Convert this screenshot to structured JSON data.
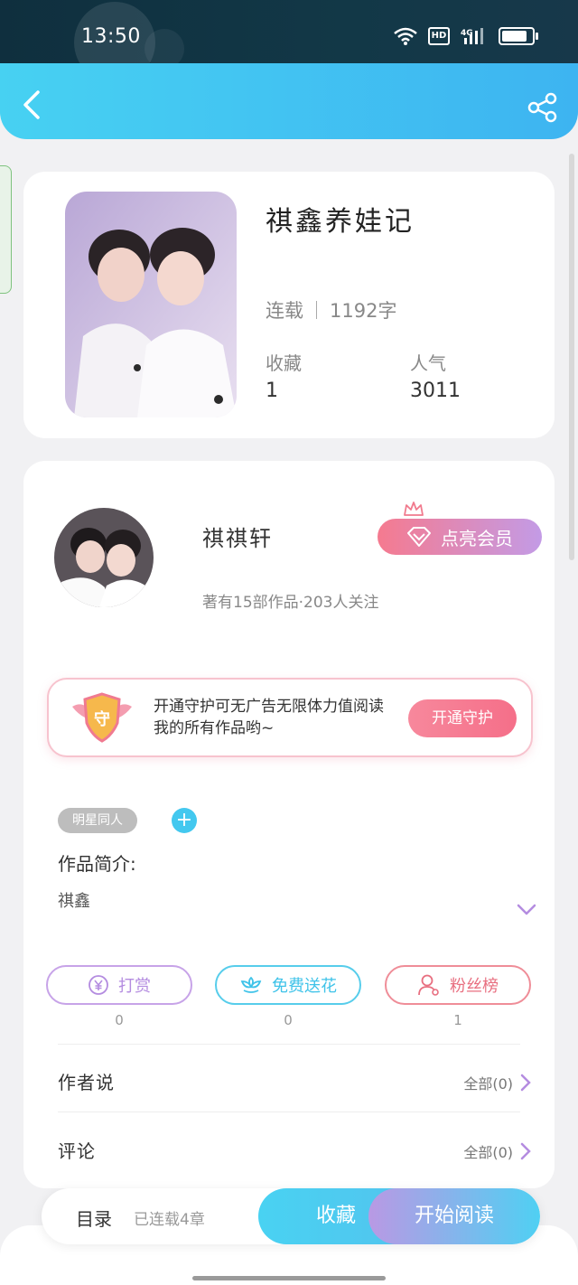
{
  "status": {
    "time": "13:50",
    "hd": "HD",
    "network": "4G",
    "battery_level": 0.85
  },
  "book": {
    "title": "祺鑫养娃记",
    "status": "连载",
    "word_count": "1192字",
    "favorites_label": "收藏",
    "favorites_value": "1",
    "popularity_label": "人气",
    "popularity_value": "3011"
  },
  "author": {
    "name": "祺祺轩",
    "stats": "著有15部作品·203人关注",
    "vip_button": "点亮会员"
  },
  "guard": {
    "badge_char": "守",
    "text": "开通守护可无广告无限体力值阅读我的所有作品哟~",
    "button": "开通守护"
  },
  "tags": [
    "明星同人"
  ],
  "intro": {
    "label": "作品简介:",
    "text": "祺鑫"
  },
  "actions": [
    {
      "label": "打赏",
      "count": "0",
      "icon": "yen-icon"
    },
    {
      "label": "免费送花",
      "count": "0",
      "icon": "flower-icon"
    },
    {
      "label": "粉丝榜",
      "count": "1",
      "icon": "user-icon"
    }
  ],
  "sections": {
    "author_says": {
      "title": "作者说",
      "link": "全部(0)"
    },
    "comments": {
      "title": "评论",
      "link": "全部(0)"
    }
  },
  "dock": {
    "toc": "目录",
    "chapters": "已连载4章",
    "collect": "收藏",
    "read": "开始阅读"
  },
  "colors": {
    "accent": "#47d1f2",
    "pink": "#f57a8f",
    "purple": "#c39be6"
  }
}
